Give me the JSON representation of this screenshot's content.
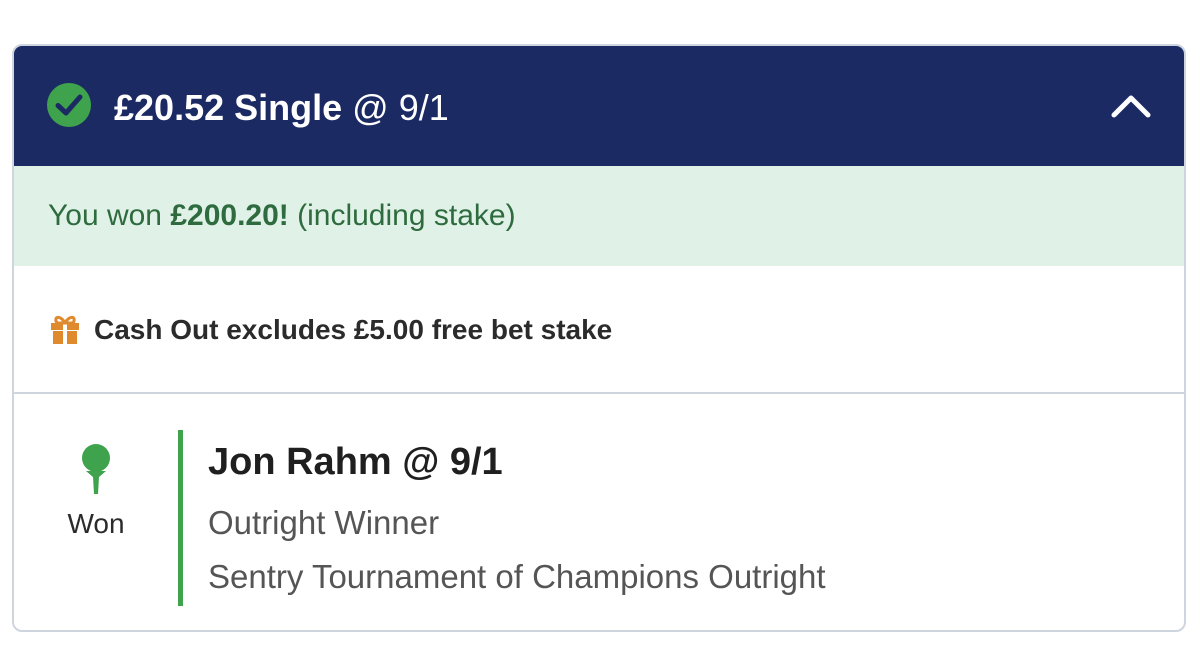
{
  "bet": {
    "stake_type": "£20.52 Single",
    "odds_suffix": "@ 9/1",
    "status_icon": "check-circle-icon",
    "collapse_icon": "chevron-up-icon"
  },
  "result_banner": {
    "prefix": "You won ",
    "amount": "£200.20!",
    "suffix": " (including stake)"
  },
  "cashout_notice": {
    "icon": "gift-icon",
    "text": "Cash Out excludes £5.00 free bet stake"
  },
  "selection": {
    "icon": "golf-tee-icon",
    "result": "Won",
    "name": "Jon Rahm @ 9/1",
    "market": "Outright Winner",
    "event": "Sentry Tournament of Champions Outright"
  },
  "colors": {
    "header_bg": "#1b2a63",
    "won_banner_bg": "#e0f2e7",
    "won_text": "#2e6b3e",
    "success_green": "#3fa34d",
    "gift_orange": "#e08a2e"
  }
}
